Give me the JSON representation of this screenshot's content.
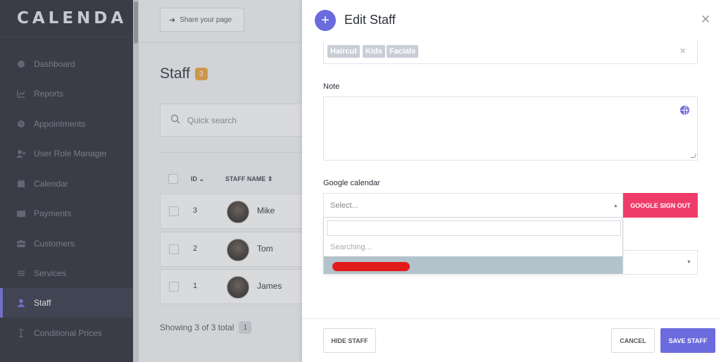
{
  "app": {
    "logo": "CALENDA"
  },
  "sidebar": {
    "items": [
      {
        "label": "Dashboard",
        "icon": "dashboard-icon"
      },
      {
        "label": "Reports",
        "icon": "chart-icon"
      },
      {
        "label": "Appointments",
        "icon": "clock-icon"
      },
      {
        "label": "User Role Manager",
        "icon": "user-plus-icon"
      },
      {
        "label": "Calendar",
        "icon": "calendar-icon"
      },
      {
        "label": "Payments",
        "icon": "wallet-icon"
      },
      {
        "label": "Customers",
        "icon": "users-icon"
      },
      {
        "label": "Services",
        "icon": "list-icon"
      },
      {
        "label": "Staff",
        "icon": "user-icon",
        "active": true
      },
      {
        "label": "Conditional Prices",
        "icon": "cursor-icon"
      }
    ],
    "accent": "#6c6bdd"
  },
  "main": {
    "share_button": "Share your page",
    "title": "Staff",
    "count": "3",
    "search_placeholder": "Quick search",
    "columns": {
      "id": "ID",
      "name": "STAFF NAME"
    },
    "rows": [
      {
        "id": "3",
        "name": "Mike"
      },
      {
        "id": "2",
        "name": "Tom"
      },
      {
        "id": "1",
        "name": "James"
      }
    ],
    "showing": "Showing 3 of 3 total",
    "page": "1"
  },
  "modal": {
    "title": "Edit Staff",
    "services_tags": [
      "Haircut",
      "Kids",
      "Facials"
    ],
    "note_label": "Note",
    "google_calendar_label": "Google calendar",
    "select_placeholder": "Select...",
    "google_sign_out": "GOOGLE SIGN OUT",
    "dropdown_status": "Searching...",
    "buttons": {
      "hide": "HIDE STAFF",
      "cancel": "CANCEL",
      "save": "SAVE STAFF"
    }
  }
}
